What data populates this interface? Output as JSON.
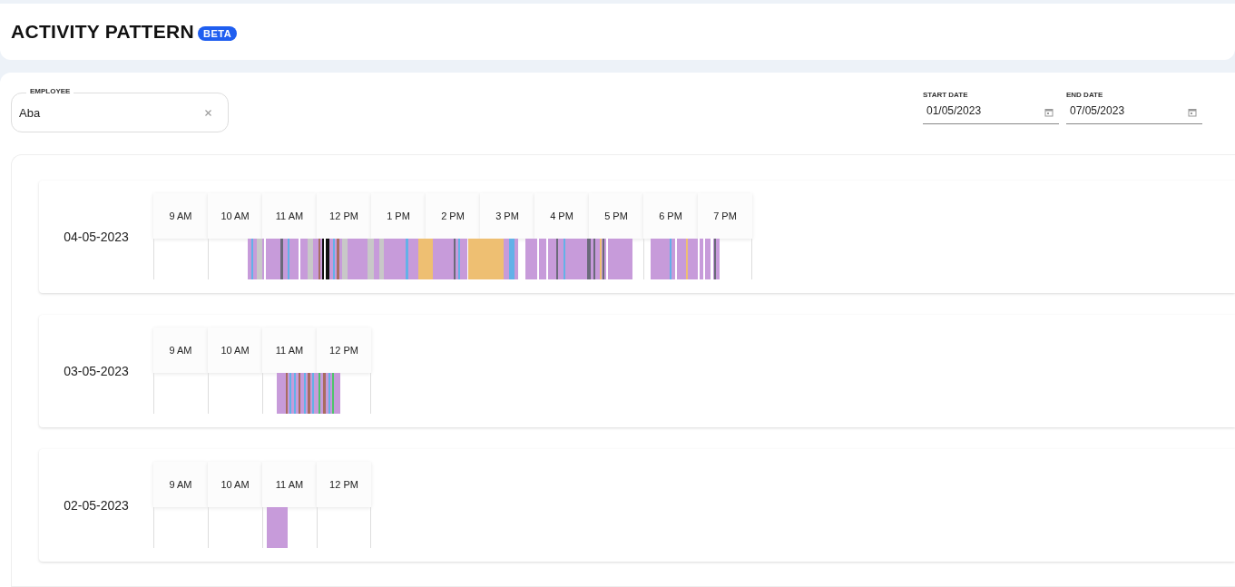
{
  "page": {
    "title": "ACTIVITY PATTERN",
    "badge": "BETA"
  },
  "filters": {
    "employee": {
      "label": "EMPLOYEE",
      "value": "Aba"
    },
    "start_date": {
      "label": "START DATE",
      "value": "01/05/2023"
    },
    "end_date": {
      "label": "END DATE",
      "value": "07/05/2023"
    }
  },
  "days": [
    {
      "date": "04-05-2023",
      "hours": [
        "9 AM",
        "10 AM",
        "11 AM",
        "12 PM",
        "1 PM",
        "2 PM",
        "3 PM",
        "4 PM",
        "5 PM",
        "6 PM",
        "7 PM"
      ]
    },
    {
      "date": "03-05-2023",
      "hours": [
        "9 AM",
        "10 AM",
        "11 AM",
        "12 PM"
      ]
    },
    {
      "date": "02-05-2023",
      "hours": [
        "9 AM",
        "10 AM",
        "11 AM",
        "12 PM"
      ]
    }
  ]
}
